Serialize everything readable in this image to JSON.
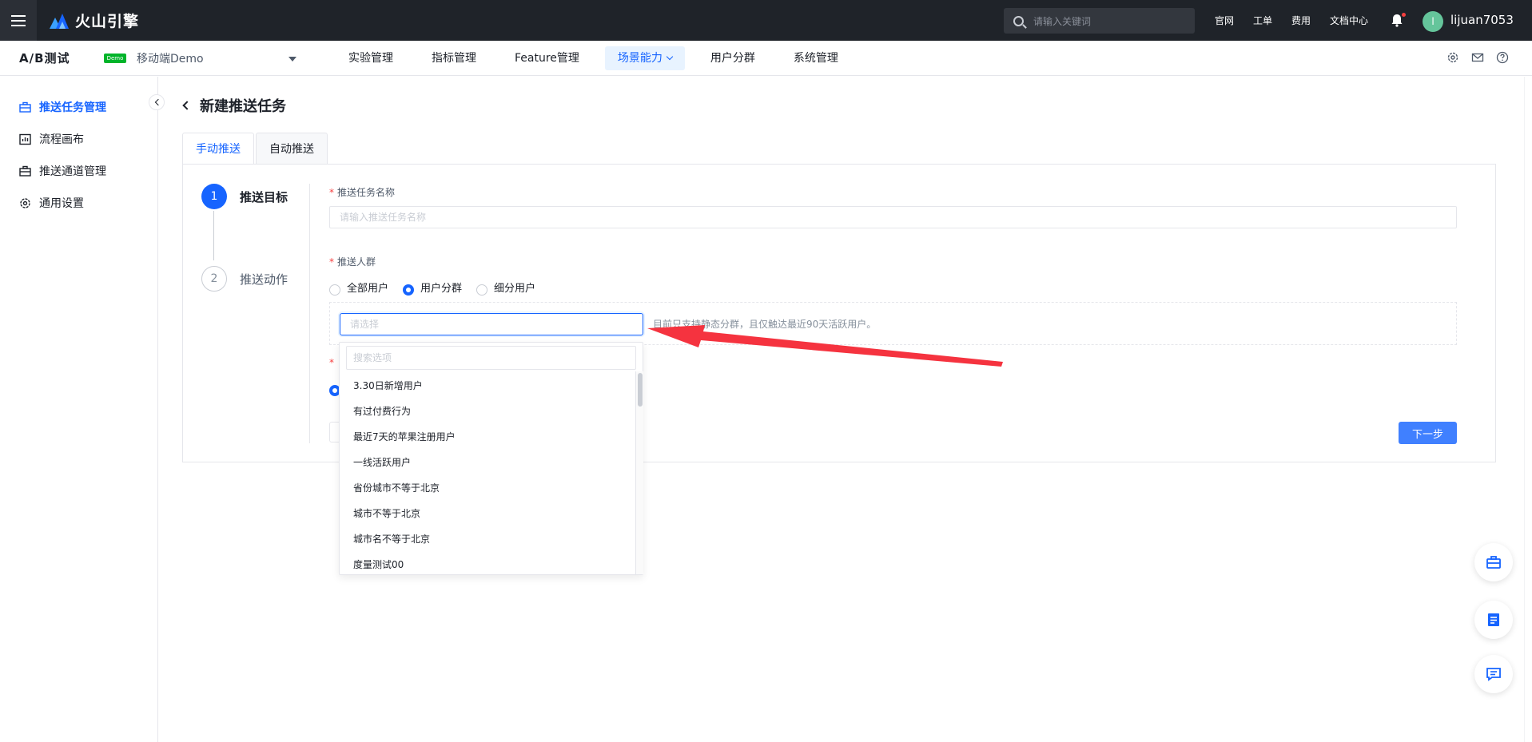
{
  "topbar": {
    "brand": "火山引擎",
    "search_placeholder": "请输入关键词",
    "links": [
      "官网",
      "工单",
      "费用",
      "文档中心"
    ],
    "avatar_letter": "l",
    "username": "lijuan7053"
  },
  "subbar": {
    "product": "A/B测试",
    "demo_badge": "Demo",
    "app_name": "移动端Demo",
    "nav": [
      "实验管理",
      "指标管理",
      "Feature管理",
      "场景能力",
      "用户分群",
      "系统管理"
    ],
    "active_nav": "场景能力"
  },
  "sidebar": {
    "items": [
      "推送任务管理",
      "流程画布",
      "推送通道管理",
      "通用设置"
    ],
    "active": "推送任务管理"
  },
  "page": {
    "title": "新建推送任务",
    "tabs": [
      "手动推送",
      "自动推送"
    ],
    "active_tab": "手动推送"
  },
  "steps": [
    {
      "number": "1",
      "label": "推送目标"
    },
    {
      "number": "2",
      "label": "推送动作"
    }
  ],
  "form": {
    "task_name_label": "推送任务名称",
    "task_name_placeholder": "请输入推送任务名称",
    "audience_label": "推送人群",
    "audience_options": [
      "全部用户",
      "用户分群",
      "细分用户"
    ],
    "audience_selected": "用户分群",
    "segment_placeholder": "请选择",
    "hint": "目前只支持静态分群，且仅触达最近90天活跃用户。",
    "next_button": "下一步"
  },
  "dropdown": {
    "search_placeholder": "搜索选项",
    "options": [
      "3.30日新增用户",
      "有过付费行为",
      "最近7天的苹果注册用户",
      "一线活跃用户",
      "省份城市不等于北京",
      "城市不等于北京",
      "城市名不等于北京",
      "度量测试00"
    ]
  },
  "colors": {
    "primary": "#1664ff",
    "topbar_bg": "#1f2329",
    "annotation_arrow": "#f5333f",
    "demo_badge": "#00b42a"
  }
}
